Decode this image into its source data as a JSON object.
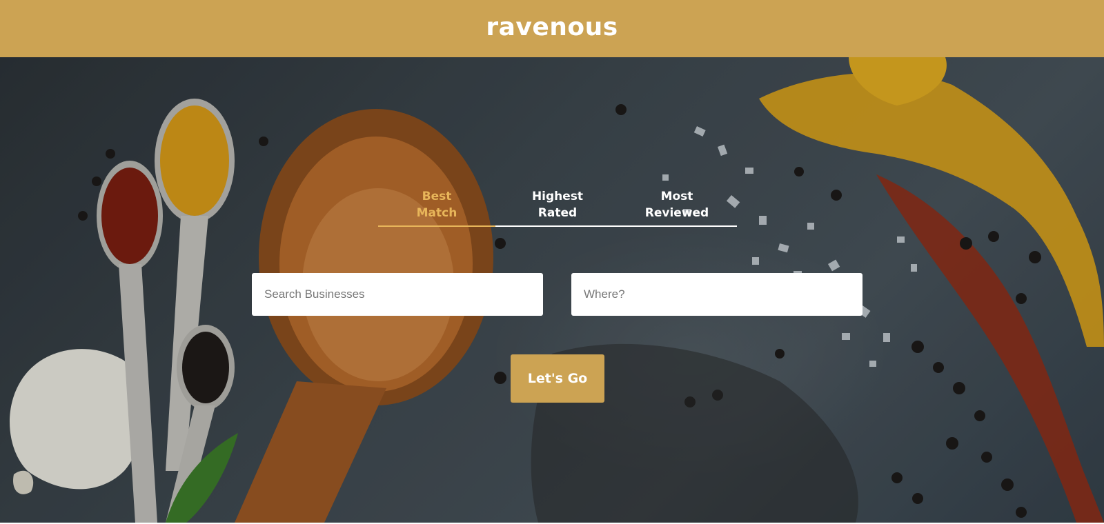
{
  "header": {
    "logo": "ravenous"
  },
  "sort_tabs": [
    {
      "label_line1": "Best",
      "label_line2": "Match",
      "active": true
    },
    {
      "label_line1": "Highest",
      "label_line2": "Rated",
      "active": false
    },
    {
      "label_line1": "Most",
      "label_line2": "Reviewed",
      "active": false
    }
  ],
  "search": {
    "business_placeholder": "Search Businesses",
    "location_placeholder": "Where?",
    "business_value": "",
    "location_value": ""
  },
  "actions": {
    "submit_label": "Let's Go"
  },
  "colors": {
    "brand": "#cca353",
    "active_tab": "#e8b65a",
    "text_light": "#ffffff"
  }
}
